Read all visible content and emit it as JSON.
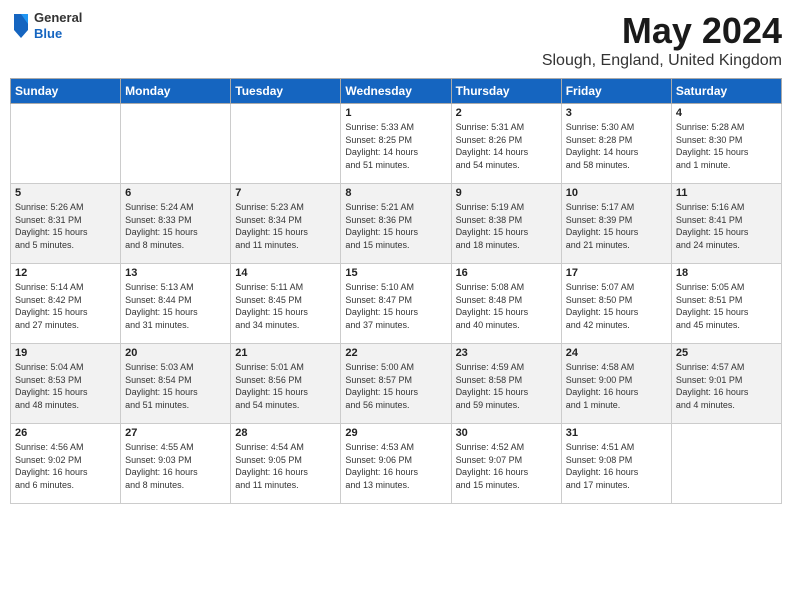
{
  "header": {
    "logo": {
      "general": "General",
      "blue": "Blue"
    },
    "title": "May 2024",
    "subtitle": "Slough, England, United Kingdom"
  },
  "days_of_week": [
    "Sunday",
    "Monday",
    "Tuesday",
    "Wednesday",
    "Thursday",
    "Friday",
    "Saturday"
  ],
  "weeks": [
    [
      {
        "day": "",
        "info": ""
      },
      {
        "day": "",
        "info": ""
      },
      {
        "day": "",
        "info": ""
      },
      {
        "day": "1",
        "info": "Sunrise: 5:33 AM\nSunset: 8:25 PM\nDaylight: 14 hours\nand 51 minutes."
      },
      {
        "day": "2",
        "info": "Sunrise: 5:31 AM\nSunset: 8:26 PM\nDaylight: 14 hours\nand 54 minutes."
      },
      {
        "day": "3",
        "info": "Sunrise: 5:30 AM\nSunset: 8:28 PM\nDaylight: 14 hours\nand 58 minutes."
      },
      {
        "day": "4",
        "info": "Sunrise: 5:28 AM\nSunset: 8:30 PM\nDaylight: 15 hours\nand 1 minute."
      }
    ],
    [
      {
        "day": "5",
        "info": "Sunrise: 5:26 AM\nSunset: 8:31 PM\nDaylight: 15 hours\nand 5 minutes."
      },
      {
        "day": "6",
        "info": "Sunrise: 5:24 AM\nSunset: 8:33 PM\nDaylight: 15 hours\nand 8 minutes."
      },
      {
        "day": "7",
        "info": "Sunrise: 5:23 AM\nSunset: 8:34 PM\nDaylight: 15 hours\nand 11 minutes."
      },
      {
        "day": "8",
        "info": "Sunrise: 5:21 AM\nSunset: 8:36 PM\nDaylight: 15 hours\nand 15 minutes."
      },
      {
        "day": "9",
        "info": "Sunrise: 5:19 AM\nSunset: 8:38 PM\nDaylight: 15 hours\nand 18 minutes."
      },
      {
        "day": "10",
        "info": "Sunrise: 5:17 AM\nSunset: 8:39 PM\nDaylight: 15 hours\nand 21 minutes."
      },
      {
        "day": "11",
        "info": "Sunrise: 5:16 AM\nSunset: 8:41 PM\nDaylight: 15 hours\nand 24 minutes."
      }
    ],
    [
      {
        "day": "12",
        "info": "Sunrise: 5:14 AM\nSunset: 8:42 PM\nDaylight: 15 hours\nand 27 minutes."
      },
      {
        "day": "13",
        "info": "Sunrise: 5:13 AM\nSunset: 8:44 PM\nDaylight: 15 hours\nand 31 minutes."
      },
      {
        "day": "14",
        "info": "Sunrise: 5:11 AM\nSunset: 8:45 PM\nDaylight: 15 hours\nand 34 minutes."
      },
      {
        "day": "15",
        "info": "Sunrise: 5:10 AM\nSunset: 8:47 PM\nDaylight: 15 hours\nand 37 minutes."
      },
      {
        "day": "16",
        "info": "Sunrise: 5:08 AM\nSunset: 8:48 PM\nDaylight: 15 hours\nand 40 minutes."
      },
      {
        "day": "17",
        "info": "Sunrise: 5:07 AM\nSunset: 8:50 PM\nDaylight: 15 hours\nand 42 minutes."
      },
      {
        "day": "18",
        "info": "Sunrise: 5:05 AM\nSunset: 8:51 PM\nDaylight: 15 hours\nand 45 minutes."
      }
    ],
    [
      {
        "day": "19",
        "info": "Sunrise: 5:04 AM\nSunset: 8:53 PM\nDaylight: 15 hours\nand 48 minutes."
      },
      {
        "day": "20",
        "info": "Sunrise: 5:03 AM\nSunset: 8:54 PM\nDaylight: 15 hours\nand 51 minutes."
      },
      {
        "day": "21",
        "info": "Sunrise: 5:01 AM\nSunset: 8:56 PM\nDaylight: 15 hours\nand 54 minutes."
      },
      {
        "day": "22",
        "info": "Sunrise: 5:00 AM\nSunset: 8:57 PM\nDaylight: 15 hours\nand 56 minutes."
      },
      {
        "day": "23",
        "info": "Sunrise: 4:59 AM\nSunset: 8:58 PM\nDaylight: 15 hours\nand 59 minutes."
      },
      {
        "day": "24",
        "info": "Sunrise: 4:58 AM\nSunset: 9:00 PM\nDaylight: 16 hours\nand 1 minute."
      },
      {
        "day": "25",
        "info": "Sunrise: 4:57 AM\nSunset: 9:01 PM\nDaylight: 16 hours\nand 4 minutes."
      }
    ],
    [
      {
        "day": "26",
        "info": "Sunrise: 4:56 AM\nSunset: 9:02 PM\nDaylight: 16 hours\nand 6 minutes."
      },
      {
        "day": "27",
        "info": "Sunrise: 4:55 AM\nSunset: 9:03 PM\nDaylight: 16 hours\nand 8 minutes."
      },
      {
        "day": "28",
        "info": "Sunrise: 4:54 AM\nSunset: 9:05 PM\nDaylight: 16 hours\nand 11 minutes."
      },
      {
        "day": "29",
        "info": "Sunrise: 4:53 AM\nSunset: 9:06 PM\nDaylight: 16 hours\nand 13 minutes."
      },
      {
        "day": "30",
        "info": "Sunrise: 4:52 AM\nSunset: 9:07 PM\nDaylight: 16 hours\nand 15 minutes."
      },
      {
        "day": "31",
        "info": "Sunrise: 4:51 AM\nSunset: 9:08 PM\nDaylight: 16 hours\nand 17 minutes."
      },
      {
        "day": "",
        "info": ""
      }
    ]
  ]
}
